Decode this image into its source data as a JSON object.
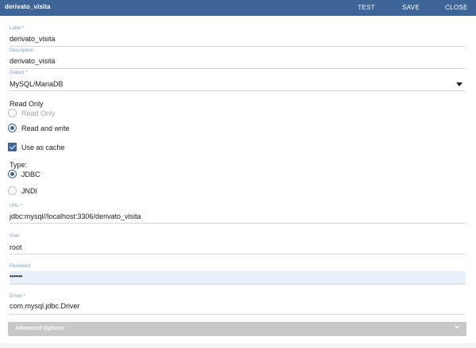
{
  "header": {
    "title": "derivato_visita",
    "actions": {
      "test": "TEST",
      "save": "SAVE",
      "close": "CLOSE"
    }
  },
  "fields": {
    "label": {
      "label": "Label *",
      "value": "derivato_visita"
    },
    "description": {
      "label": "Description",
      "value": "derivato_visita"
    },
    "dialect": {
      "label": "Dialect *",
      "value": "MySQL/MariaDB"
    },
    "url": {
      "label": "URL *",
      "value": "jdbc:mysql//localhost:3306/derivato_visita"
    },
    "user": {
      "label": "User",
      "value": "root"
    },
    "password": {
      "label": "Password",
      "value": "•••••••"
    },
    "driver": {
      "label": "Driver *",
      "value": "com.mysql.jdbc.Driver"
    }
  },
  "access": {
    "heading": "Read Only",
    "options": [
      {
        "label": "Read Only",
        "selected": false
      },
      {
        "label": "Read and write",
        "selected": true
      }
    ]
  },
  "cache": {
    "label": "Use as cache",
    "checked": true
  },
  "type": {
    "heading": "Type:",
    "options": [
      {
        "label": "JDBC",
        "selected": true
      },
      {
        "label": "JNDI",
        "selected": false
      }
    ]
  },
  "advanced": {
    "label": "Advanced Options"
  },
  "colors": {
    "accent": "#3d6597",
    "floating_label": "#7ba0c4",
    "autofill": "#e8f0fe"
  }
}
